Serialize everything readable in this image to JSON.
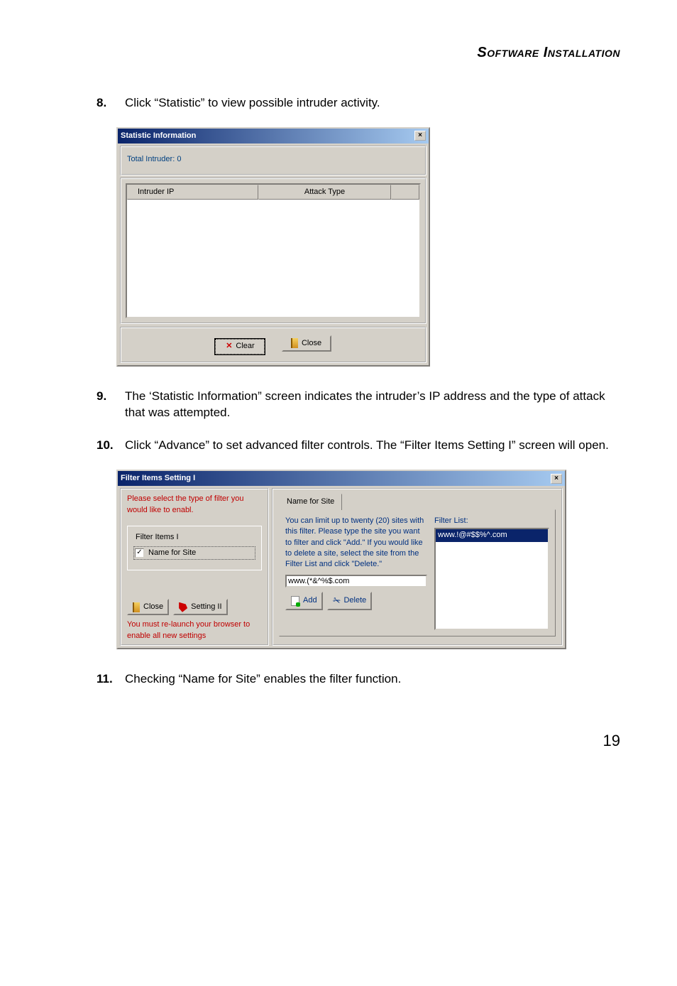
{
  "header": {
    "title": "Software Installation"
  },
  "steps": {
    "s8": {
      "num": "8.",
      "text": "Click “Statistic” to view possible intruder activity."
    },
    "s9": {
      "num": "9.",
      "text": "The ‘Statistic Information” screen indicates the intruder’s IP address and the type of attack that was attempted."
    },
    "s10": {
      "num": "10.",
      "text": "Click “Advance” to set advanced filter controls. The “Filter Items Setting I” screen will open."
    },
    "s11": {
      "num": "11.",
      "text": "Checking “Name for Site” enables the filter function."
    }
  },
  "statDialog": {
    "title": "Statistic Information",
    "totalIntruder": "Total Intruder:  0",
    "columns": {
      "ip": "Intruder IP",
      "attack": "Attack Type"
    },
    "clear": "Clear",
    "close": "Close"
  },
  "filterDialog": {
    "title": "Filter Items  Setting I",
    "intro": "Please select the type of filter you would like to enabl.",
    "fieldsetLegend": "Filter Items I",
    "checkboxLabel": "Name for Site",
    "closeBtn": "Close",
    "settingBtn": "Setting II",
    "relaunch": "You must re-launch your browser to enable all new settings",
    "tab": "Name for  Site",
    "helpText": "You can limit up to twenty (20) sites with this filter. Please type the site you want to filter and click \"Add.\"  If you would like to delete a site, select the site from the Filter List and click \"Delete.\"",
    "inputValue": "www.(*&^%$.com",
    "addBtn": "Add",
    "deleteBtn": "Delete",
    "filterListLabel": "Filter List:",
    "filterListItem": "www.!@#$$%^.com"
  },
  "pageNumber": "19"
}
